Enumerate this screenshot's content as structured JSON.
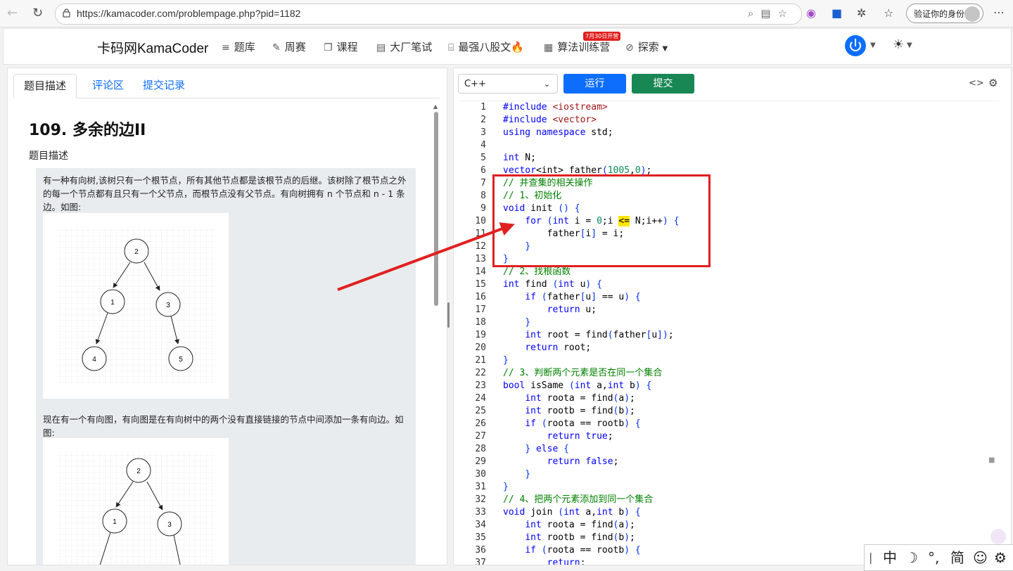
{
  "browser": {
    "url": "https://kamacoder.com/problempage.php?pid=1182",
    "profile_label": "验证你的身份"
  },
  "site": {
    "logo": "卡码网KamaCoder",
    "nav": [
      "题库",
      "周赛",
      "课程",
      "大厂笔试",
      "最强八股文🔥",
      "算法训练营",
      "探索"
    ],
    "badge": "7月30日开营"
  },
  "problem": {
    "tabs": [
      "题目描述",
      "评论区",
      "提交记录"
    ],
    "title": "109. 多余的边II",
    "section": "题目描述",
    "para1": "有一种有向树,该树只有一个根节点，所有其他节点都是该根节点的后继。该树除了根节点之外的每一个节点都有且只有一个父节点，而根节点没有父节点。有向树拥有 n 个节点和 n - 1 条边。如图:",
    "para2": "现在有一个有向图，有向图是在有向树中的两个没有直接链接的节点中间添加一条有向边。如图:",
    "graph1_nodes": [
      "2",
      "1",
      "3",
      "4",
      "5"
    ],
    "graph2_nodes": [
      "2",
      "1",
      "3"
    ]
  },
  "editor": {
    "language": "C++",
    "run_label": "运行",
    "submit_label": "提交",
    "lines": [
      "#include <iostream>",
      "#include <vector>",
      "using namespace std;",
      "",
      "int N;",
      "vector<int> father(1005,0);",
      "// 并查集的相关操作",
      "// 1、初始化",
      "void init () {",
      "    for (int i = 0;i <= N;i++) {",
      "        father[i] = i;",
      "    }",
      "}",
      "// 2、找根函数",
      "int find (int u) {",
      "    if (father[u] == u) {",
      "        return u;",
      "    }",
      "    int root = find(father[u]);",
      "    return root;",
      "}",
      "// 3、判断两个元素是否在同一个集合",
      "bool isSame (int a,int b) {",
      "    int roota = find(a);",
      "    int rootb = find(b);",
      "    if (roota == rootb) {",
      "        return true;",
      "    } else {",
      "        return false;",
      "    }",
      "}",
      "// 4、把两个元素添加到同一个集合",
      "void join (int a,int b) {",
      "    int roota = find(a);",
      "    int rootb = find(b);",
      "    if (roota == rootb) {",
      "        return;"
    ]
  },
  "ime": {
    "items": [
      "中",
      "☽",
      "°,",
      "简",
      "☺",
      "⚙"
    ]
  }
}
